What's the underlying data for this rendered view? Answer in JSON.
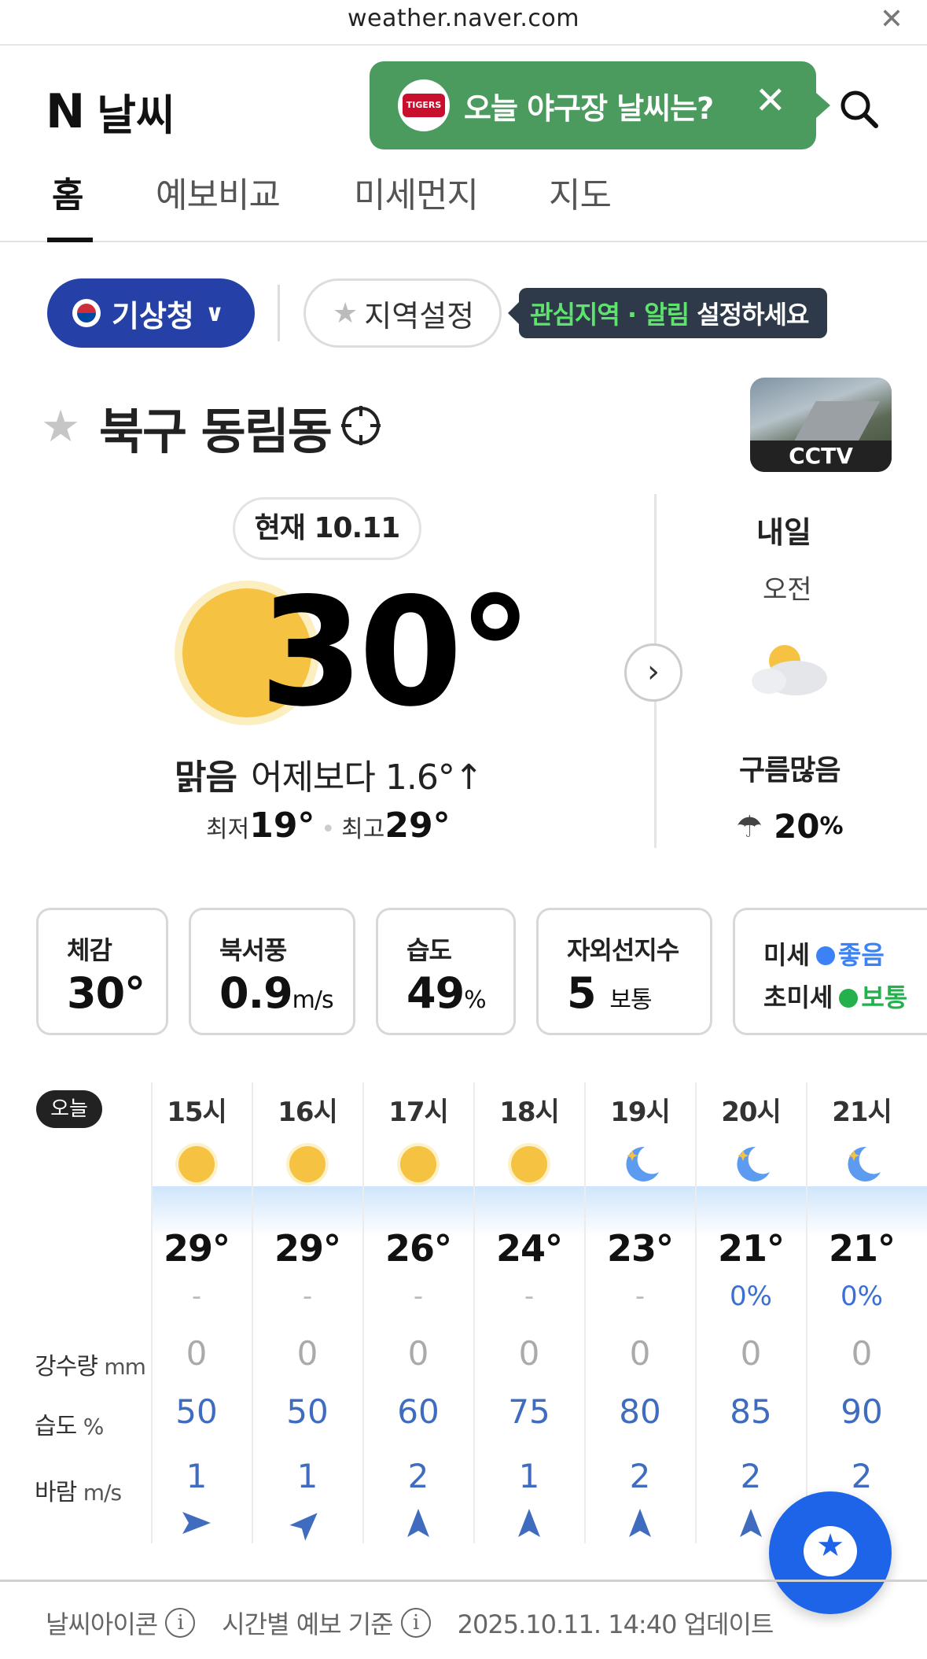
{
  "browser": {
    "url": "weather.naver.com",
    "close_icon": "close-icon"
  },
  "header": {
    "logo_n": "N",
    "logo_title": "날씨",
    "promo_badge": "TIGERS",
    "promo_text": "오늘 야구장 날씨는?",
    "promo_color": "#4b9a5e"
  },
  "tabs": [
    "홈",
    "예보비교",
    "미세먼지",
    "지도"
  ],
  "source": {
    "label": "기상청",
    "region_button": "지역설정",
    "tip_highlight": "관심지역 · 알림",
    "tip_rest": " 설정하세요"
  },
  "location": {
    "name": "북구 동림동",
    "cctv_label": "CCTV"
  },
  "current": {
    "time_label": "현재 10.11",
    "temp": "30°",
    "condition": "맑음",
    "compare": "어제보다 1.6°↑",
    "min_label": "최저",
    "min": "19°",
    "max_label": "최고",
    "max": "29°"
  },
  "tomorrow": {
    "title": "내일",
    "period": "오전",
    "condition": "구름많음",
    "rain_prob": "20",
    "rain_unit": "%"
  },
  "cards": {
    "feel": {
      "label": "체감",
      "value": "30°"
    },
    "wind": {
      "label": "북서풍",
      "value": "0.9",
      "unit": "m/s"
    },
    "humidity": {
      "label": "습도",
      "value": "49",
      "unit": "%"
    },
    "uv": {
      "label": "자외선지수",
      "value": "5",
      "unit": "보통"
    },
    "air": {
      "pm10_label": "미세",
      "pm10_status": "좋음",
      "pm10_color": "#3b82f6",
      "pm25_label": "초미세",
      "pm25_status": "보통",
      "pm25_color": "#22b14c"
    }
  },
  "hourly": {
    "today_label": "오늘",
    "hours": [
      "15시",
      "16시",
      "17시",
      "18시",
      "19시",
      "20시",
      "21시"
    ],
    "icons": [
      "sun-icon",
      "sun-icon",
      "sun-icon",
      "sun-icon",
      "moon-icon",
      "moon-icon",
      "moon-icon"
    ],
    "temps": [
      "29°",
      "29°",
      "26°",
      "24°",
      "23°",
      "21°",
      "21°"
    ],
    "precip_prob": [
      "-",
      "-",
      "-",
      "-",
      "-",
      "0%",
      "0%"
    ],
    "rain_label": "강수량",
    "rain_unit": "mm",
    "rain": [
      "0",
      "0",
      "0",
      "0",
      "0",
      "0",
      "0"
    ],
    "humidity_label": "습도",
    "humidity_unit": "%",
    "humidity": [
      "50",
      "50",
      "60",
      "75",
      "80",
      "85",
      "90"
    ],
    "wind_label": "바람",
    "wind_unit": "m/s",
    "wind": [
      "1",
      "1",
      "2",
      "1",
      "2",
      "2",
      "2"
    ]
  },
  "footer": {
    "icon_label": "날씨아이콘",
    "basis_label": "시간별 예보 기준",
    "updated": "2025.10.11. 14:40 업데이트"
  }
}
